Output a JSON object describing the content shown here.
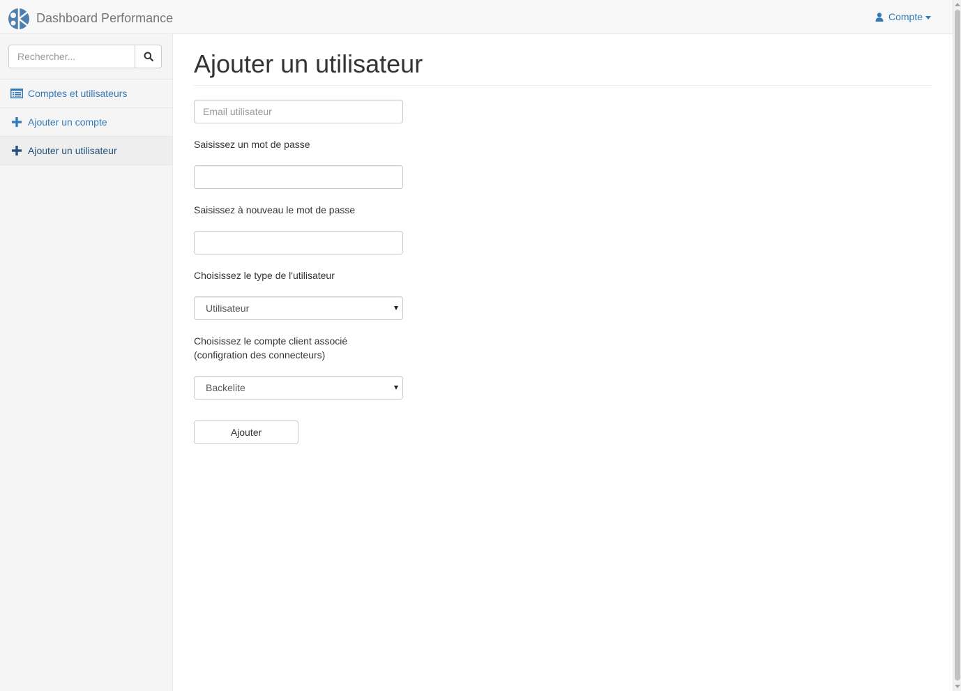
{
  "app": {
    "title": "Dashboard Performance",
    "account_label": "Compte"
  },
  "sidebar": {
    "search_placeholder": "Rechercher...",
    "items": [
      {
        "label": "Comptes et utilisateurs",
        "icon": "list-icon"
      },
      {
        "label": "Ajouter un compte",
        "icon": "plus-icon"
      },
      {
        "label": "Ajouter un utilisateur",
        "icon": "plus-icon",
        "active": true
      }
    ]
  },
  "form": {
    "title": "Ajouter un utilisateur",
    "email_placeholder": "Email utilisateur",
    "email_value": "",
    "password_label": "Saisissez un mot de passe",
    "password_value": "",
    "password_confirm_label": "Saisissez à nouveau le mot de passe",
    "password_confirm_value": "",
    "user_type_label": "Choisissez le type de l'utilisateur",
    "user_type_value": "Utilisateur",
    "client_account_label_line1": "Choisissez le compte client associé",
    "client_account_label_line2": "(configration des connecteurs)",
    "client_account_value": "Backelite",
    "submit_label": "Ajouter"
  },
  "colors": {
    "link": "#337ab7",
    "active_link": "#23527c",
    "navbar_bg": "#f8f8f8",
    "sidebar_bg": "#f5f5f5"
  }
}
